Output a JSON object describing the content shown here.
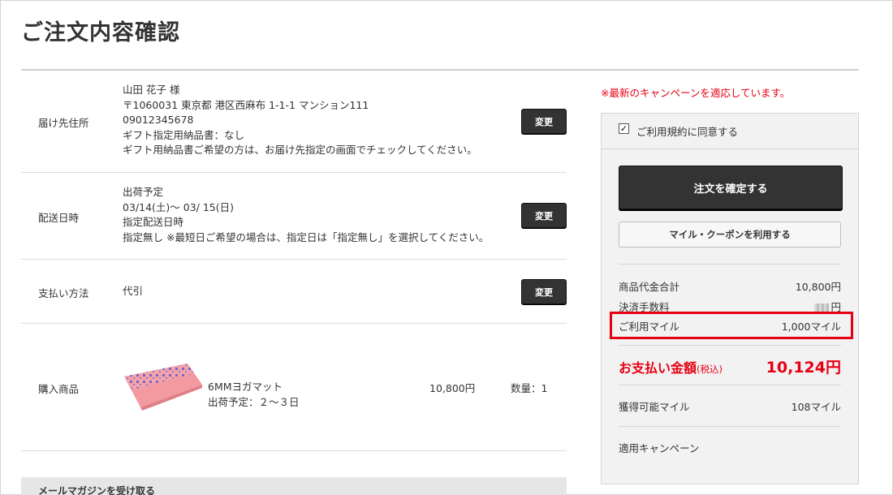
{
  "page": {
    "title": "ご注文内容確認"
  },
  "delivery_address": {
    "label": "届け先住所",
    "name": "山田 花子 様",
    "address": "〒1060031 東京都 港区西麻布 1-1-1 マンション111",
    "phone": "09012345678",
    "gift_invoice": "ギフト指定用納品書：なし",
    "gift_note": "ギフト用納品書ご希望の方は、お届け先指定の画面でチェックしてください。",
    "change_label": "変更"
  },
  "delivery_date": {
    "label": "配送日時",
    "ship_heading": "出荷予定",
    "ship_range": "03/14(土)～ 03/ 15(日)",
    "date_heading": "指定配送日時",
    "date_note": "指定無し ※最短日ご希望の場合は、指定日は「指定無し」を選択してください。",
    "change_label": "変更"
  },
  "payment": {
    "label": "支払い方法",
    "method": "代引",
    "change_label": "変更"
  },
  "products": {
    "label": "購入商品",
    "items": [
      {
        "name": "6MMヨガマット",
        "ship_estimate": "出荷予定：２～３日",
        "price": "10,800円",
        "quantity": "数量：1"
      }
    ]
  },
  "mail_magazine": {
    "label": "メールマガジンを受け取る"
  },
  "sidebar": {
    "campaign_note": "※最新のキャンペーンを適応しています。",
    "agree_label": "ご利用規約に同意する",
    "agree_checked": true,
    "confirm_button": "注文を確定する",
    "coupon_button": "マイル・クーポンを利用する",
    "subtotal_label": "商品代金合計",
    "subtotal_value": "10,800円",
    "fee_label": "決済手数料",
    "fee_value": "円",
    "miles_used_label": "ご利用マイル",
    "miles_used_value": "1,000マイル",
    "pay_label": "お支払い金額",
    "pay_tax": "(税込)",
    "pay_value": "10,124円",
    "miles_earn_label": "獲得可能マイル",
    "miles_earn_value": "108マイル",
    "campaign_label": "適用キャンペーン"
  },
  "colors": {
    "accent_red": "#e60012",
    "button_dark": "#333333",
    "product_pink": "#f4a3a8",
    "product_pattern": "#7a63c9"
  }
}
